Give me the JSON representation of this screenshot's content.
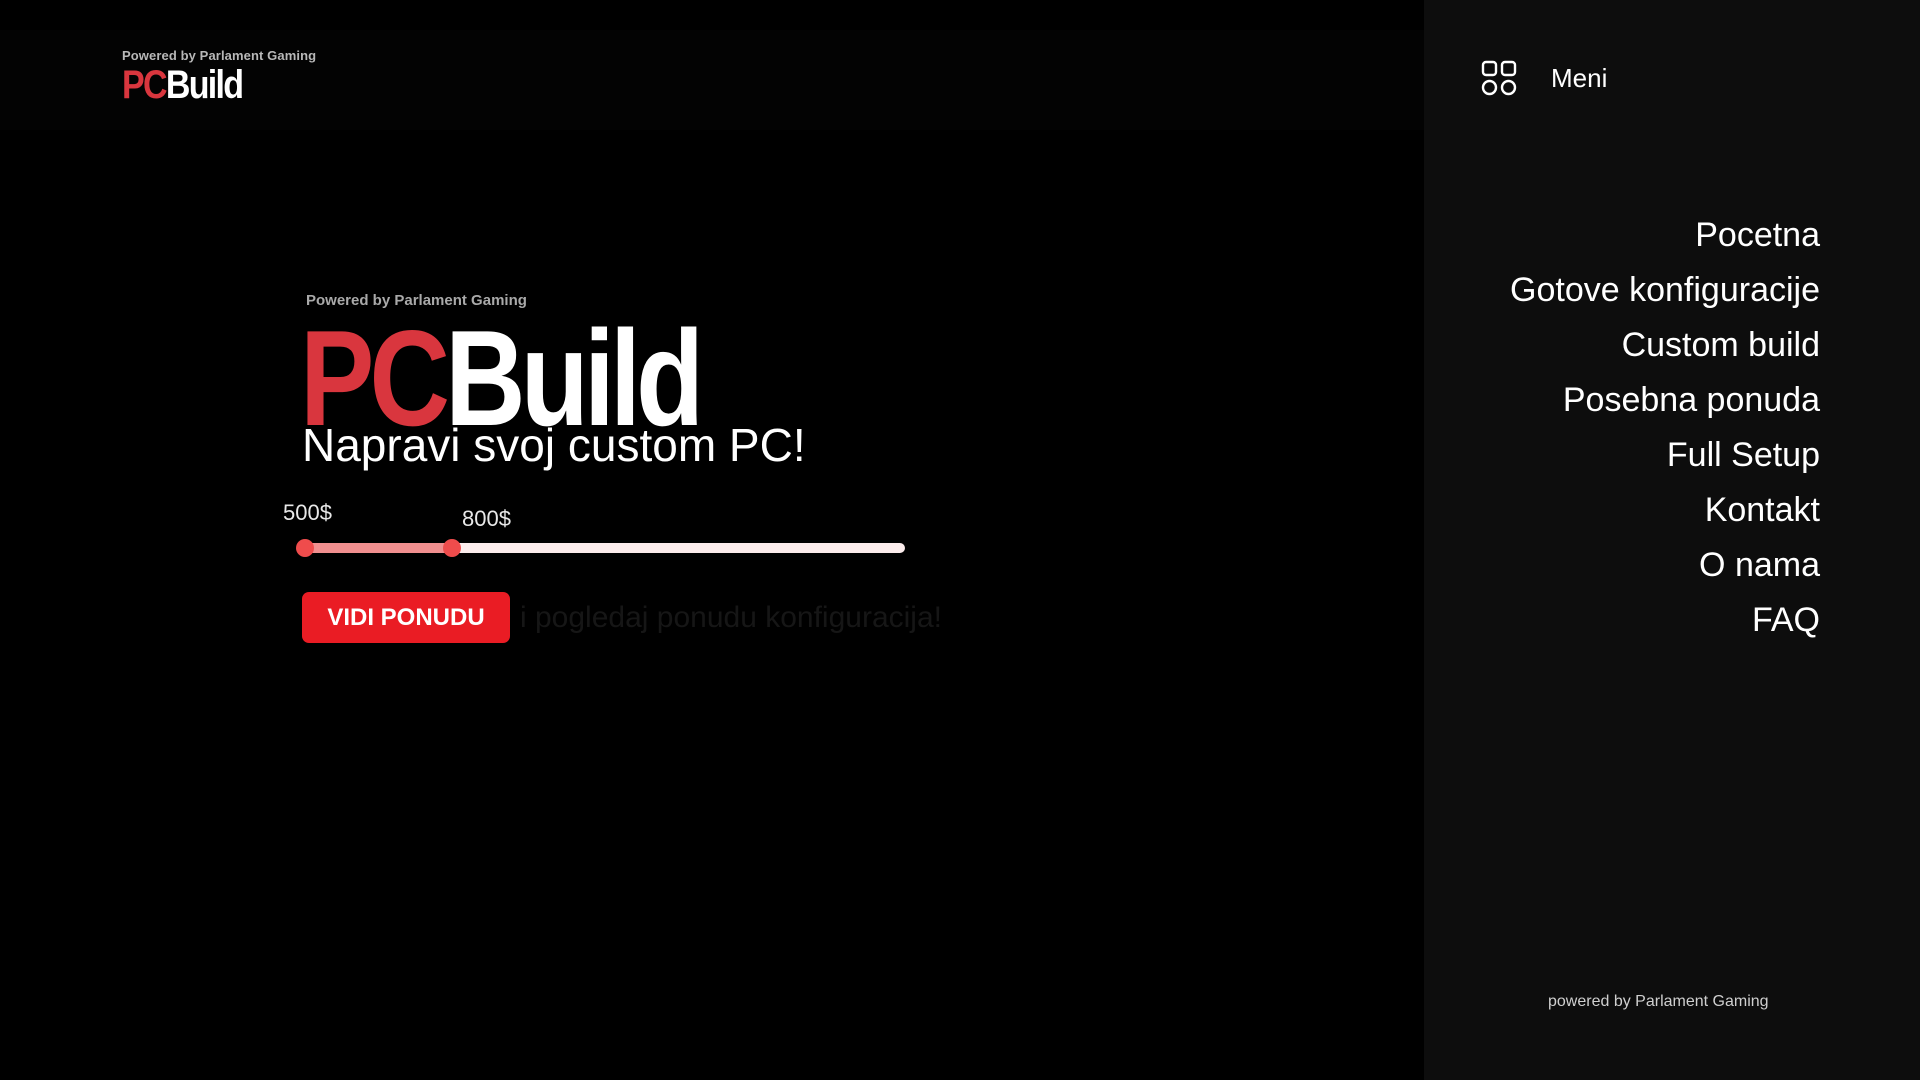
{
  "header": {
    "powered_by": "Powered by Parlament Gaming",
    "logo_pc": "PC",
    "logo_build": "Build"
  },
  "hero": {
    "powered_by": "Powered by Parlament Gaming",
    "logo_pc": "PC",
    "logo_build": "Build",
    "headline": "Napravi svoj custom PC!",
    "price_min_label": "500$",
    "price_max_label": "800$",
    "slider_range": {
      "min_fraction": 0.0,
      "max_fraction": 0.245
    },
    "cta_label": "VIDI PONUDU",
    "cta_hint": "i pogledaj ponudu konfiguracija!"
  },
  "sidebar": {
    "menu_label": "Meni",
    "nav_items": [
      {
        "label": "Pocetna"
      },
      {
        "label": "Gotove konfiguracije"
      },
      {
        "label": "Custom build"
      },
      {
        "label": "Posebna ponuda"
      },
      {
        "label": "Full Setup"
      },
      {
        "label": "Kontakt"
      },
      {
        "label": "O nama"
      },
      {
        "label": "FAQ"
      }
    ],
    "footer": "powered by Parlament Gaming",
    "icon": "grid-menu-icon"
  },
  "colors": {
    "brand_red": "#d9363e",
    "cta_red": "#ea1c24",
    "slider_fill": "#f08f8f",
    "slider_track": "#fbecec",
    "slider_thumb": "#ef4c4c",
    "background": "#000000",
    "sidebar_bg": "#0d0d0d"
  }
}
